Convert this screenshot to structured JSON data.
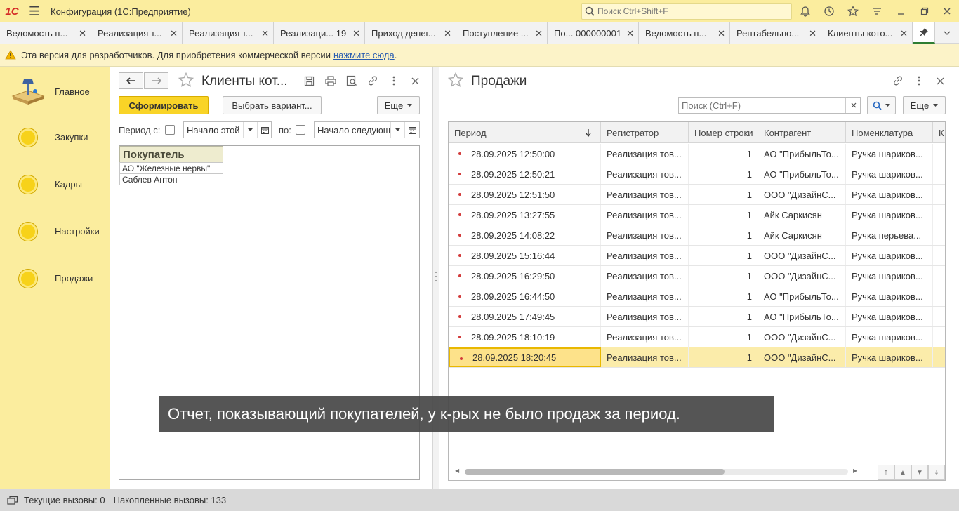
{
  "app": {
    "logo_text": "1С",
    "title": "Конфигурация  (1С:Предприятие)",
    "search_placeholder": "Поиск Ctrl+Shift+F"
  },
  "tabs": [
    {
      "label": "Ведомость п..."
    },
    {
      "label": "Реализация т..."
    },
    {
      "label": "Реализация т..."
    },
    {
      "label": "Реализаци... 19"
    },
    {
      "label": "Приход денег..."
    },
    {
      "label": "Поступление ..."
    },
    {
      "label": "По... 000000001"
    },
    {
      "label": "Ведомость п..."
    },
    {
      "label": "Рентабельно..."
    },
    {
      "label": "Клиенты кото..."
    }
  ],
  "info": {
    "text": "Эта версия для разработчиков. Для приобретения коммерческой версии",
    "link": "нажмите сюда",
    "tail": "."
  },
  "sidebar": {
    "items": [
      {
        "label": "Главное",
        "icon": "desk-lamp-icon"
      },
      {
        "label": "Закупки",
        "icon": "section-circle-icon"
      },
      {
        "label": "Кадры",
        "icon": "section-circle-icon"
      },
      {
        "label": "Настройки",
        "icon": "section-circle-icon"
      },
      {
        "label": "Продажи",
        "icon": "section-circle-icon"
      }
    ]
  },
  "left_form": {
    "title": "Клиенты кот...",
    "generate_label": "Сформировать",
    "variant_label": "Выбрать вариант...",
    "more_label": "Еще",
    "period_from_label": "Период с:",
    "period_from_value": "Начало этой",
    "period_to_label": "по:",
    "period_to_value": "Начало следующ",
    "report": {
      "header": "Покупатель",
      "rows": [
        "АО \"Железные нервы\"",
        "Саблев Антон"
      ]
    }
  },
  "right_form": {
    "title": "Продажи",
    "search_placeholder": "Поиск (Ctrl+F)",
    "more_label": "Еще",
    "columns": [
      "Период",
      "Регистратор",
      "Номер строки",
      "Контрагент",
      "Номенклатура",
      "К"
    ],
    "rows": [
      {
        "period": "28.09.2025 12:50:00",
        "registrar": "Реализация тов...",
        "line": "1",
        "counterparty": "АО \"ПрибыльТо...",
        "item": "Ручка шариков..."
      },
      {
        "period": "28.09.2025 12:50:21",
        "registrar": "Реализация тов...",
        "line": "1",
        "counterparty": "АО \"ПрибыльТо...",
        "item": "Ручка шариков..."
      },
      {
        "period": "28.09.2025 12:51:50",
        "registrar": "Реализация тов...",
        "line": "1",
        "counterparty": "ООО \"ДизайнС...",
        "item": "Ручка шариков..."
      },
      {
        "period": "28.09.2025 13:27:55",
        "registrar": "Реализация тов...",
        "line": "1",
        "counterparty": "Айк Саркисян",
        "item": "Ручка шариков..."
      },
      {
        "period": "28.09.2025 14:08:22",
        "registrar": "Реализация тов...",
        "line": "1",
        "counterparty": "Айк Саркисян",
        "item": "Ручка перьева..."
      },
      {
        "period": "28.09.2025 15:16:44",
        "registrar": "Реализация тов...",
        "line": "1",
        "counterparty": "ООО \"ДизайнС...",
        "item": "Ручка шариков..."
      },
      {
        "period": "28.09.2025 16:29:50",
        "registrar": "Реализация тов...",
        "line": "1",
        "counterparty": "ООО \"ДизайнС...",
        "item": "Ручка шариков..."
      },
      {
        "period": "28.09.2025 16:44:50",
        "registrar": "Реализация тов...",
        "line": "1",
        "counterparty": "АО \"ПрибыльТо...",
        "item": "Ручка шариков..."
      },
      {
        "period": "28.09.2025 17:49:45",
        "registrar": "Реализация тов...",
        "line": "1",
        "counterparty": "АО \"ПрибыльТо...",
        "item": "Ручка шариков..."
      },
      {
        "period": "28.09.2025 18:10:19",
        "registrar": "Реализация тов...",
        "line": "1",
        "counterparty": "ООО \"ДизайнС...",
        "item": "Ручка шариков..."
      },
      {
        "period": "28.09.2025 18:20:45",
        "registrar": "Реализация тов...",
        "line": "1",
        "counterparty": "ООО \"ДизайнС...",
        "item": "Ручка шариков..."
      }
    ],
    "selected_row": 10
  },
  "status": {
    "current_calls": "Текущие вызовы: 0",
    "accumulated_calls": "Накопленные вызовы: 133"
  },
  "caption": "Отчет, показывающий покупателей, у к-рых не было продаж за период.",
  "colors": {
    "accent_yellow": "#fbed9e",
    "generate_button": "#f9d427",
    "selected_row": "#fbecaa",
    "pin_underline": "#2e7d32"
  }
}
